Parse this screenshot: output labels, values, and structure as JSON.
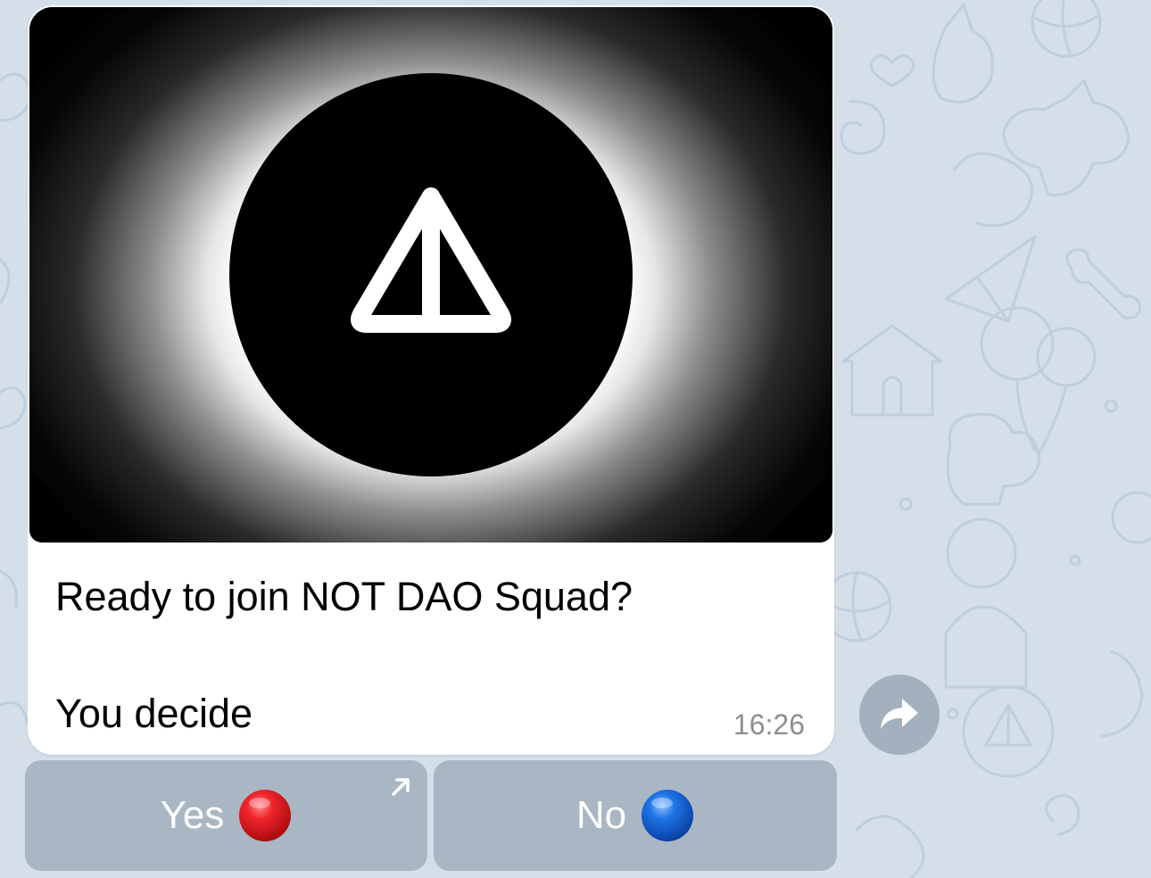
{
  "message": {
    "caption_line1": "Ready to join NOT DAO Squad?",
    "caption_line2": "You decide",
    "time": "16:26",
    "photo": {
      "subject": "notcoin-logo-eclipse"
    }
  },
  "keyboard": {
    "buttons": [
      {
        "label": "Yes",
        "emoji": "red-circle",
        "emoji_color": "#e0191e",
        "has_link_arrow": true
      },
      {
        "label": "No",
        "emoji": "blue-circle",
        "emoji_color": "#1a6fe0",
        "has_link_arrow": false
      }
    ]
  },
  "colors": {
    "wallpaper": "#d4dfe9",
    "button_bg": "#a9b7c4",
    "share_bg": "#a3b1bf",
    "time": "#8a8f94"
  },
  "icons": {
    "share": "share-forward-icon",
    "link": "arrow-up-right-icon"
  }
}
